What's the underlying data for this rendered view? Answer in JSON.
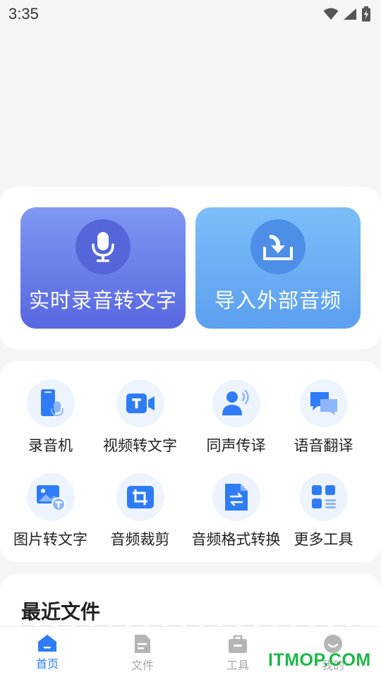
{
  "status_bar": {
    "time": "3:35"
  },
  "primary_actions": [
    {
      "label": "实时录音转文字",
      "icon": "microphone-icon"
    },
    {
      "label": "导入外部音频",
      "icon": "download-icon"
    }
  ],
  "tools": [
    {
      "label": "录音机",
      "icon": "recorder-icon"
    },
    {
      "label": "视频转文字",
      "icon": "video-text-icon"
    },
    {
      "label": "同声传译",
      "icon": "interpreter-icon"
    },
    {
      "label": "语音翻译",
      "icon": "chat-translate-icon"
    },
    {
      "label": "图片转文字",
      "icon": "image-text-icon"
    },
    {
      "label": "音频裁剪",
      "icon": "crop-icon"
    },
    {
      "label": "音频格式转换",
      "icon": "format-convert-icon"
    },
    {
      "label": "更多工具",
      "icon": "grid-icon"
    }
  ],
  "recent": {
    "title": "最近文件"
  },
  "tab_bar": [
    {
      "label": "首页",
      "icon": "home-icon",
      "active": true
    },
    {
      "label": "文件",
      "icon": "file-icon",
      "active": false
    },
    {
      "label": "工具",
      "icon": "toolbox-icon",
      "active": false
    },
    {
      "label": "我的",
      "icon": "profile-icon",
      "active": false
    }
  ],
  "watermark": "ITMOP.COM",
  "colors": {
    "accent": "#2f7cf6",
    "tool_icon": "#2f7cf6",
    "tab_inactive": "#a8a8a8",
    "watermark": "#1db84a"
  }
}
